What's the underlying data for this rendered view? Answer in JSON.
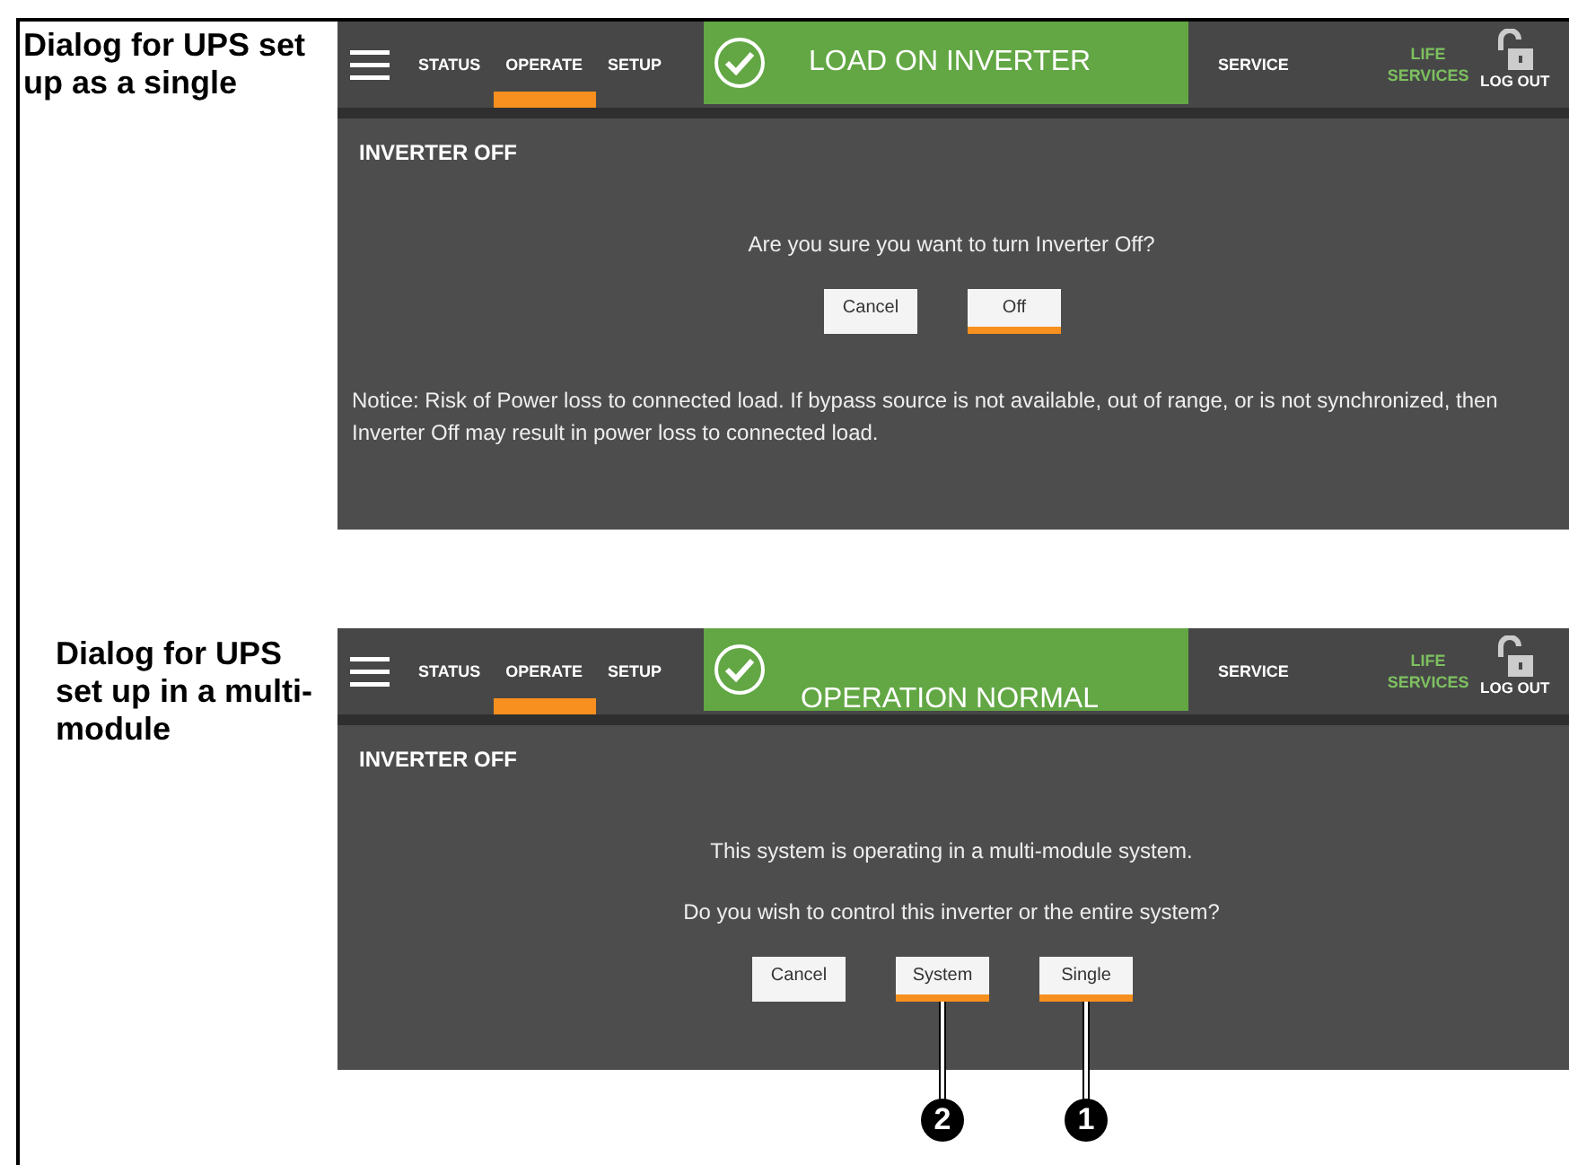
{
  "figures": [
    {
      "caption": "Dialog for UPS set up as a single",
      "header": {
        "tabs": [
          {
            "label": "STATUS",
            "selected": false
          },
          {
            "label": "OPERATE",
            "selected": true
          },
          {
            "label": "SETUP",
            "selected": false
          }
        ],
        "banner": {
          "text": "LOAD ON INVERTER",
          "scrolled": false
        },
        "service": "SERVICE",
        "life_services": "LIFE SERVICES",
        "logout": "LOG OUT"
      },
      "dialog": {
        "title": "INVERTER OFF",
        "messages": [
          "Are you sure you want to turn Inverter Off?"
        ],
        "buttons": [
          {
            "label": "Cancel",
            "highlighted": false
          },
          {
            "label": "Off",
            "highlighted": true
          }
        ],
        "notice": "Notice: Risk of Power loss to connected load. If bypass source is not available, out of range, or is not synchronized, then Inverter Off may result in power loss to connected load."
      }
    },
    {
      "caption": "Dialog for UPS set up in a multi-module",
      "header": {
        "tabs": [
          {
            "label": "STATUS",
            "selected": false
          },
          {
            "label": "OPERATE",
            "selected": true
          },
          {
            "label": "SETUP",
            "selected": false
          }
        ],
        "banner": {
          "text": "OPERATION NORMAL",
          "scrolled": true
        },
        "service": "SERVICE",
        "life_services": "LIFE SERVICES",
        "logout": "LOG OUT"
      },
      "dialog": {
        "title": "INVERTER OFF",
        "messages": [
          "This system is operating in a multi-module system.",
          "Do you wish to control this inverter or the entire system?"
        ],
        "buttons": [
          {
            "label": "Cancel",
            "highlighted": false
          },
          {
            "label": "System",
            "highlighted": true,
            "callout": "2"
          },
          {
            "label": "Single",
            "highlighted": true,
            "callout": "1"
          }
        ]
      }
    }
  ]
}
